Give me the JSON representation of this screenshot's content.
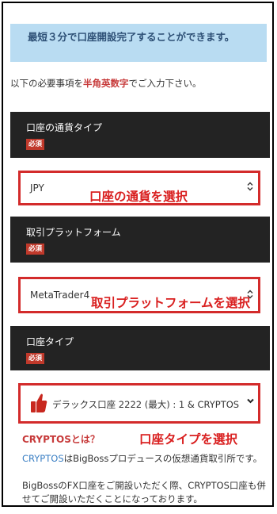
{
  "notice": "最短３分で口座開設完了することができます。",
  "intro": {
    "before": "以下の必要事項を",
    "highlight": "半角英数字",
    "after": "でご入力下さい。"
  },
  "required_badge": "必須",
  "sections": [
    {
      "label": "口座の通貨タイプ",
      "value": "JPY",
      "annotation": "口座の通貨を選択"
    },
    {
      "label": "取引プラットフォーム",
      "value": "MetaTrader4",
      "annotation": "取引プラットフォームを選択"
    },
    {
      "label": "口座タイプ",
      "value": "デラックス口座 2222 (最大) : 1 & CRYPTOS",
      "annotation": "口座タイプを選択"
    }
  ],
  "crypto": {
    "title": "CRYPTOSとは？",
    "link": "CRYPTOS",
    "para1_rest": "はBigBossプロデュースの仮想通貨取引所です。",
    "para2": "BigBossのFX口座をご開設いただく際、CRYPTOS口座も併せてご開設いただくことになっております。"
  },
  "icons": {
    "select_arrow": "updown-chevron-icon",
    "thumb": "thumbs-up-icon",
    "dropdown": "chevron-down-icon"
  }
}
